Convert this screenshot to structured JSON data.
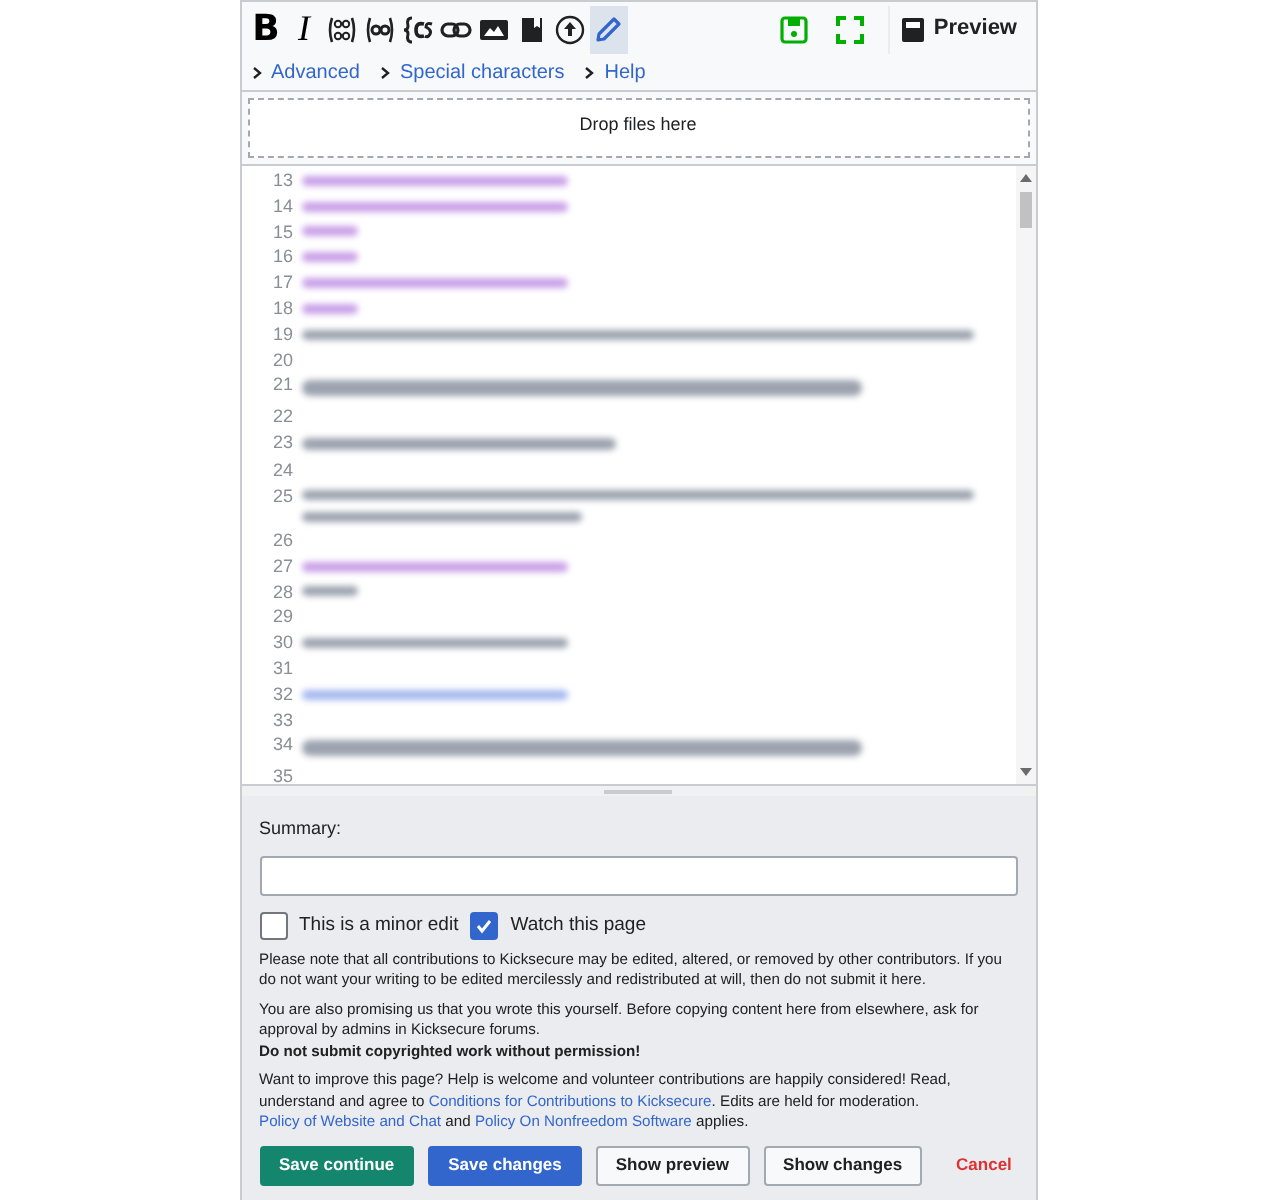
{
  "toolbar": {
    "tools": [
      {
        "kind": "bold",
        "label": "B"
      },
      {
        "kind": "italic",
        "label": "I"
      },
      {
        "kind": "comment"
      },
      {
        "kind": "code"
      },
      {
        "kind": "template"
      },
      {
        "kind": "link"
      },
      {
        "kind": "image"
      },
      {
        "kind": "bookmark"
      },
      {
        "kind": "upload"
      },
      {
        "kind": "pencil",
        "selected": true
      }
    ],
    "preview": "Preview"
  },
  "links": [
    "Advanced",
    "Special characters",
    "Help"
  ],
  "drop_zone": "Drop files here",
  "editor": {
    "lines": [
      {
        "number": "13",
        "kind": "code",
        "color": "#c9a0e8"
      },
      {
        "number": "14",
        "kind": "code",
        "color": "#c9a0e8"
      },
      {
        "number": "15",
        "kind": "short",
        "color": "#c9a0e8"
      },
      {
        "number": "16",
        "kind": "short",
        "color": "#c9a0e8"
      },
      {
        "number": "17",
        "kind": "code",
        "color": "#c9a0e8"
      },
      {
        "number": "18",
        "kind": "short",
        "color": "#c9a0e8"
      },
      {
        "number": "19",
        "kind": "long",
        "color": "#9ca3af"
      },
      {
        "number": "20",
        "kind": "empty"
      },
      {
        "number": "21",
        "kind": "heading",
        "color": "#9ca3af"
      },
      {
        "number": "22",
        "kind": "empty"
      },
      {
        "number": "23",
        "kind": "subheading",
        "color": "#9ca3af"
      },
      {
        "number": "24",
        "kind": "empty"
      },
      {
        "number": "25",
        "kind": "wrapped",
        "color": "#9ca3af"
      },
      {
        "number": "26",
        "kind": "empty"
      },
      {
        "number": "27",
        "kind": "code",
        "color": "#c9a0e8"
      },
      {
        "number": "28",
        "kind": "short",
        "color": "#9ca3af"
      },
      {
        "number": "29",
        "kind": "empty"
      },
      {
        "number": "30",
        "kind": "code",
        "color": "#9ca3af"
      },
      {
        "number": "31",
        "kind": "empty"
      },
      {
        "number": "32",
        "kind": "code",
        "color": "#a5b8f0"
      },
      {
        "number": "33",
        "kind": "empty"
      },
      {
        "number": "34",
        "kind": "heading",
        "color": "#9ca3af"
      },
      {
        "number": "35",
        "kind": "empty"
      }
    ]
  },
  "summary": {
    "label": "Summary:"
  },
  "options": [
    {
      "label": "This is a minor edit",
      "checked": false
    },
    {
      "label": "Watch this page",
      "checked": true
    }
  ],
  "notices": [
    {
      "parts": [
        {
          "text": "Please note that all contributions to Kicksecure may be edited, altered, or removed by other contributors. If you do not want your writing to be edited mercilessly and redistributed at will, then do not submit it here."
        }
      ]
    },
    {
      "parts": [
        {
          "text": "You are also promising us that you wrote this yourself. Before copying content here from elsewhere, ask for approval by admins in Kicksecure forums."
        }
      ]
    },
    {
      "bold": true,
      "parts": [
        {
          "text": "Do not submit copyrighted work without permission!"
        }
      ]
    },
    {
      "parts": [
        {
          "text": "Want to improve this page? Help is welcome and volunteer contributions are happily considered! Read, understand and agree to "
        },
        {
          "text": "Conditions for Contributions to Kicksecure",
          "link": true
        },
        {
          "text": ". Edits are held for moderation. "
        },
        {
          "text": "Policy of Website and Chat",
          "link": true
        },
        {
          "text": " and "
        },
        {
          "text": "Policy On Nonfreedom Software",
          "link": true
        },
        {
          "text": " applies."
        }
      ]
    }
  ],
  "buttons": [
    {
      "label": "Save continue",
      "kind": "success"
    },
    {
      "label": "Save changes",
      "kind": "primary"
    },
    {
      "label": "Show preview",
      "kind": "normal"
    },
    {
      "label": "Show changes",
      "kind": "normal"
    },
    {
      "label": "Cancel",
      "kind": "danger"
    }
  ]
}
